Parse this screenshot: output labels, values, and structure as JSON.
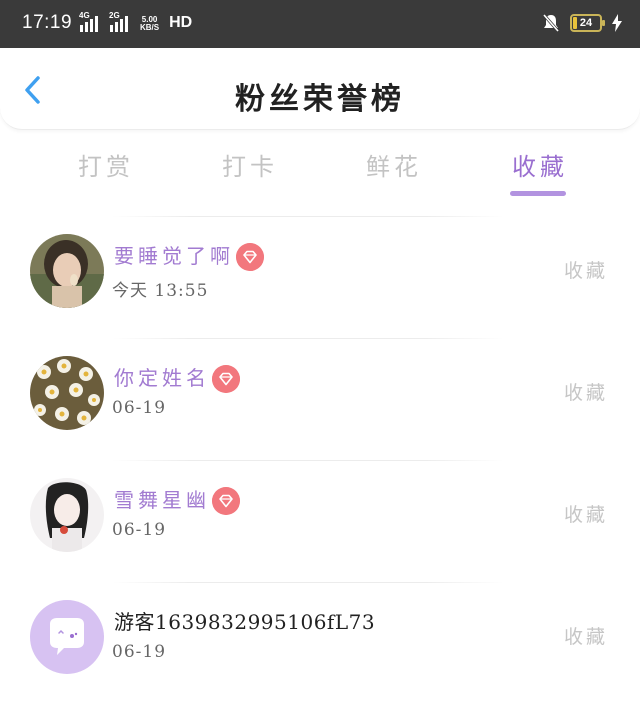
{
  "status_bar": {
    "time": "17:19",
    "net1_tag": "4G",
    "net2_tag": "2G",
    "speed_value": "5.00",
    "speed_unit": "KB/S",
    "hd_label": "HD",
    "battery_level": "24"
  },
  "header": {
    "title": "粉丝荣誉榜"
  },
  "tabs": [
    {
      "label": "打赏",
      "active": false
    },
    {
      "label": "打卡",
      "active": false
    },
    {
      "label": "鲜花",
      "active": false
    },
    {
      "label": "收藏",
      "active": true
    }
  ],
  "fans": [
    {
      "name": "要睡觉了啊",
      "date": "今天 13:55",
      "vip": true,
      "action": "收藏"
    },
    {
      "name": "你定姓名",
      "date": "06-19",
      "vip": true,
      "action": "收藏"
    },
    {
      "name": "雪舞星幽",
      "date": "06-19",
      "vip": true,
      "action": "收藏"
    },
    {
      "name": "游客1639832995106fL73",
      "date": "06-19",
      "vip": false,
      "action": "收藏"
    }
  ],
  "colors": {
    "accent": "#9a6fd0",
    "tab_underline": "#b293e0",
    "vip_badge": "#f2777d",
    "status_bar_bg": "#3a3a3a",
    "back_arrow": "#3fa0f0"
  }
}
